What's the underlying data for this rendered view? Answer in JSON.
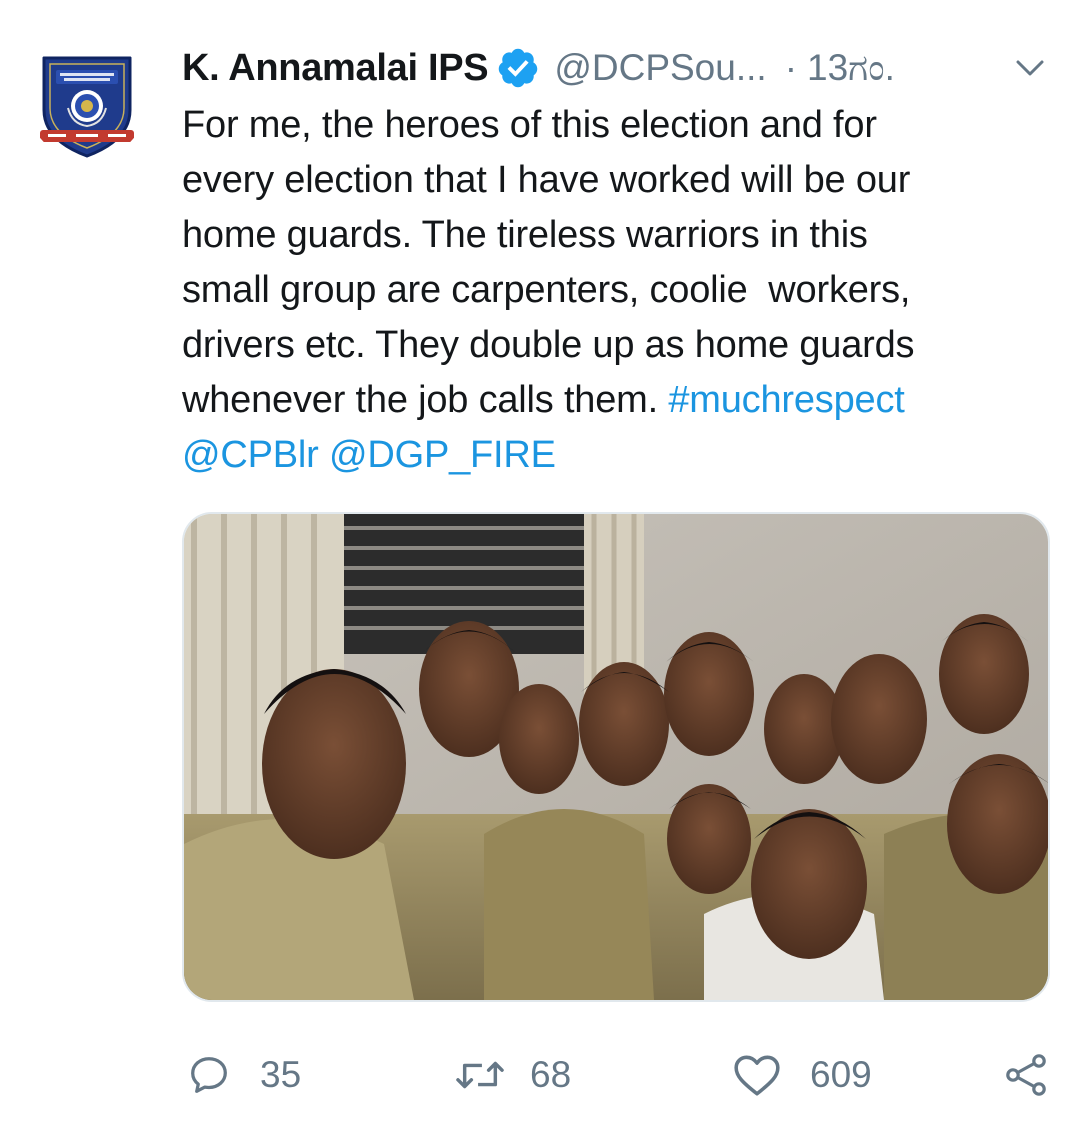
{
  "tweet": {
    "author_name": "K. Annamalai IPS",
    "handle": "@DCPSou...",
    "separator": "·",
    "time": "13ಗಂ.",
    "avatar_icon": "police-badge-icon",
    "verified_icon": "verified-badge-icon",
    "menu_icon": "chevron-down-icon",
    "text_lines": [
      "For me, the heroes of this election and for",
      "every election that I have worked will be our",
      "home guards. The tireless warriors in this",
      "small group are carpenters, coolie  workers,",
      "drivers etc. They double up as home guards"
    ],
    "last_line_text": "whenever the job calls them. ",
    "hashtag": "#muchrespect",
    "mentions": [
      "@CPBlr",
      "@DGP_FIRE"
    ],
    "mention_separator": " ",
    "photo_icon": "group-photo-image"
  },
  "actions": {
    "reply": {
      "icon": "reply-icon",
      "count": "35"
    },
    "retweet": {
      "icon": "retweet-icon",
      "count": "68"
    },
    "like": {
      "icon": "heart-icon",
      "count": "609"
    },
    "share": {
      "icon": "share-icon"
    }
  },
  "colors": {
    "text": "#14171a",
    "secondary": "#657786",
    "link": "#1b95e0",
    "verified": "#1da1f2",
    "badge_navy": "#1f3b8c"
  }
}
